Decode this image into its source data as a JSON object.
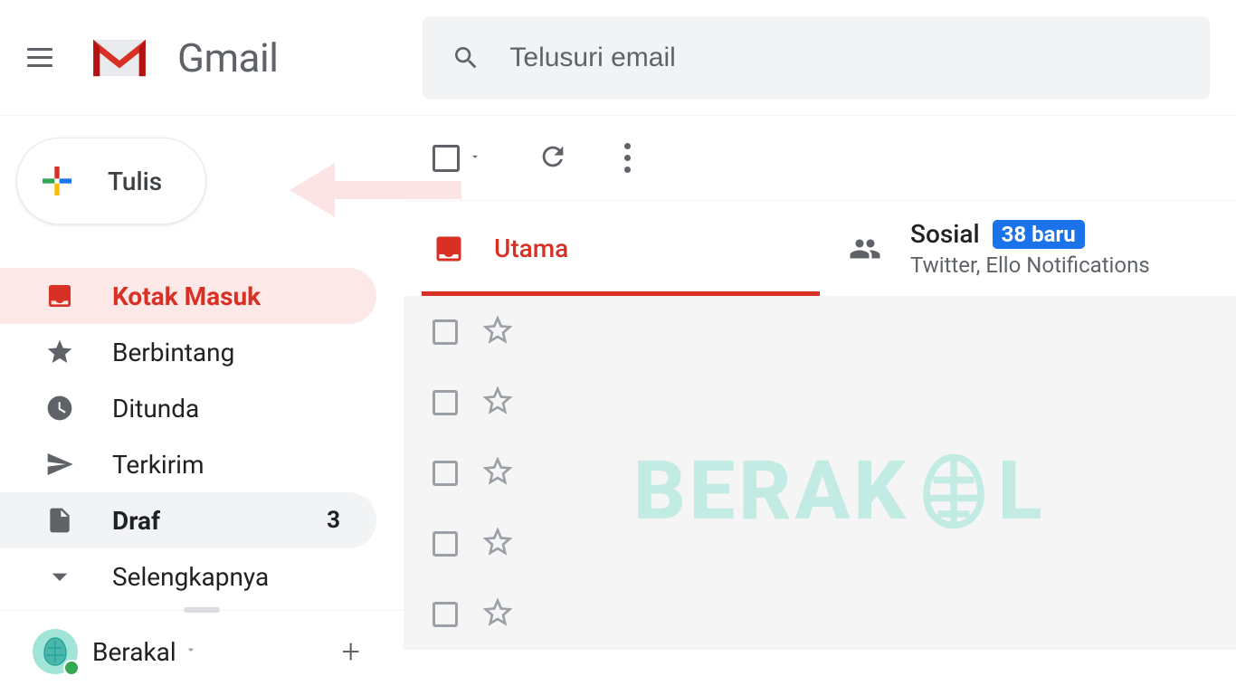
{
  "header": {
    "app_name": "Gmail",
    "search_placeholder": "Telusuri email"
  },
  "compose": {
    "label": "Tulis"
  },
  "sidebar": {
    "items": [
      {
        "label": "Kotak Masuk",
        "icon": "inbox",
        "active": true
      },
      {
        "label": "Berbintang",
        "icon": "star"
      },
      {
        "label": "Ditunda",
        "icon": "clock"
      },
      {
        "label": "Terkirim",
        "icon": "send"
      },
      {
        "label": "Draf",
        "icon": "file",
        "count": "3",
        "bold": true
      },
      {
        "label": "Selengkapnya",
        "icon": "chevron"
      }
    ]
  },
  "hangouts": {
    "name": "Berakal"
  },
  "tabs": {
    "primary": {
      "label": "Utama"
    },
    "social": {
      "label": "Sosial",
      "badge": "38 baru",
      "subtitle": "Twitter, Ello Notifications"
    }
  },
  "watermark": "BERAK L"
}
